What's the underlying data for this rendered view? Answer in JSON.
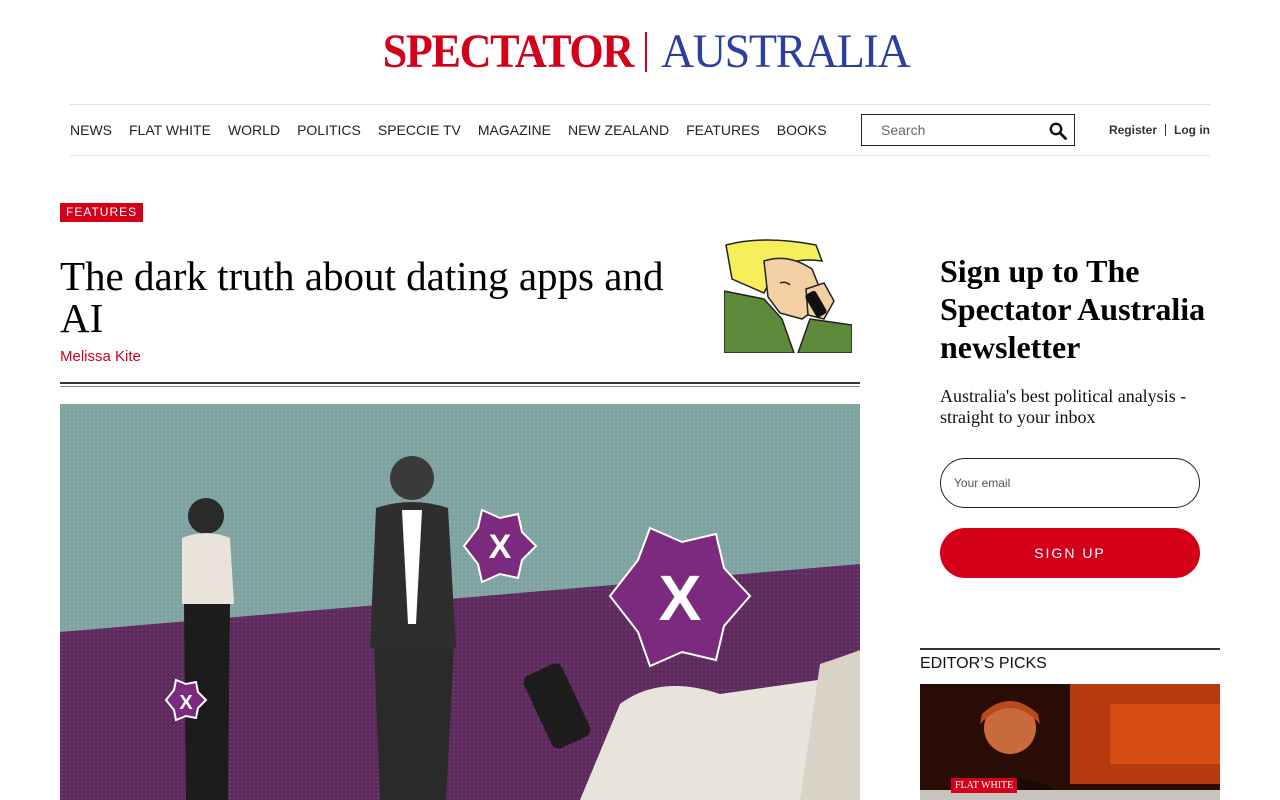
{
  "masthead": {
    "brand_left": "SPECTATOR",
    "brand_right": "AUSTRALIA"
  },
  "nav": {
    "items": [
      {
        "label": "NEWS",
        "key": "news"
      },
      {
        "label": "FLAT WHITE",
        "key": "flat-white"
      },
      {
        "label": "WORLD",
        "key": "world"
      },
      {
        "label": "POLITICS",
        "key": "politics"
      },
      {
        "label": "SPECCIE TV",
        "key": "speccie-tv"
      },
      {
        "label": "MAGAZINE",
        "key": "magazine"
      },
      {
        "label": "NEW ZEALAND",
        "key": "new-zealand"
      },
      {
        "label": "FEATURES",
        "key": "features"
      },
      {
        "label": "BOOKS",
        "key": "books"
      }
    ],
    "search_placeholder": "Search",
    "register_label": "Register",
    "login_label": "Log in"
  },
  "article": {
    "tag": "FEATURES",
    "headline": "The dark truth about dating apps and AI",
    "author": "Melissa Kite"
  },
  "newsletter": {
    "title": "Sign up to The Spectator Australia newsletter",
    "subtitle": "Australia's best political analysis - straight to your inbox",
    "email_placeholder": "Your email",
    "button_label": "SIGN UP"
  },
  "editors_picks": {
    "title": "EDITOR’S PICKS",
    "first_tag": "FLAT WHITE"
  },
  "colors": {
    "brand_red": "#d40019",
    "brand_blue": "#2a3f9f",
    "hero_teal": "#7ea3a1",
    "hero_purple": "#5e2a5e"
  },
  "icons": {
    "search": "search-icon"
  }
}
